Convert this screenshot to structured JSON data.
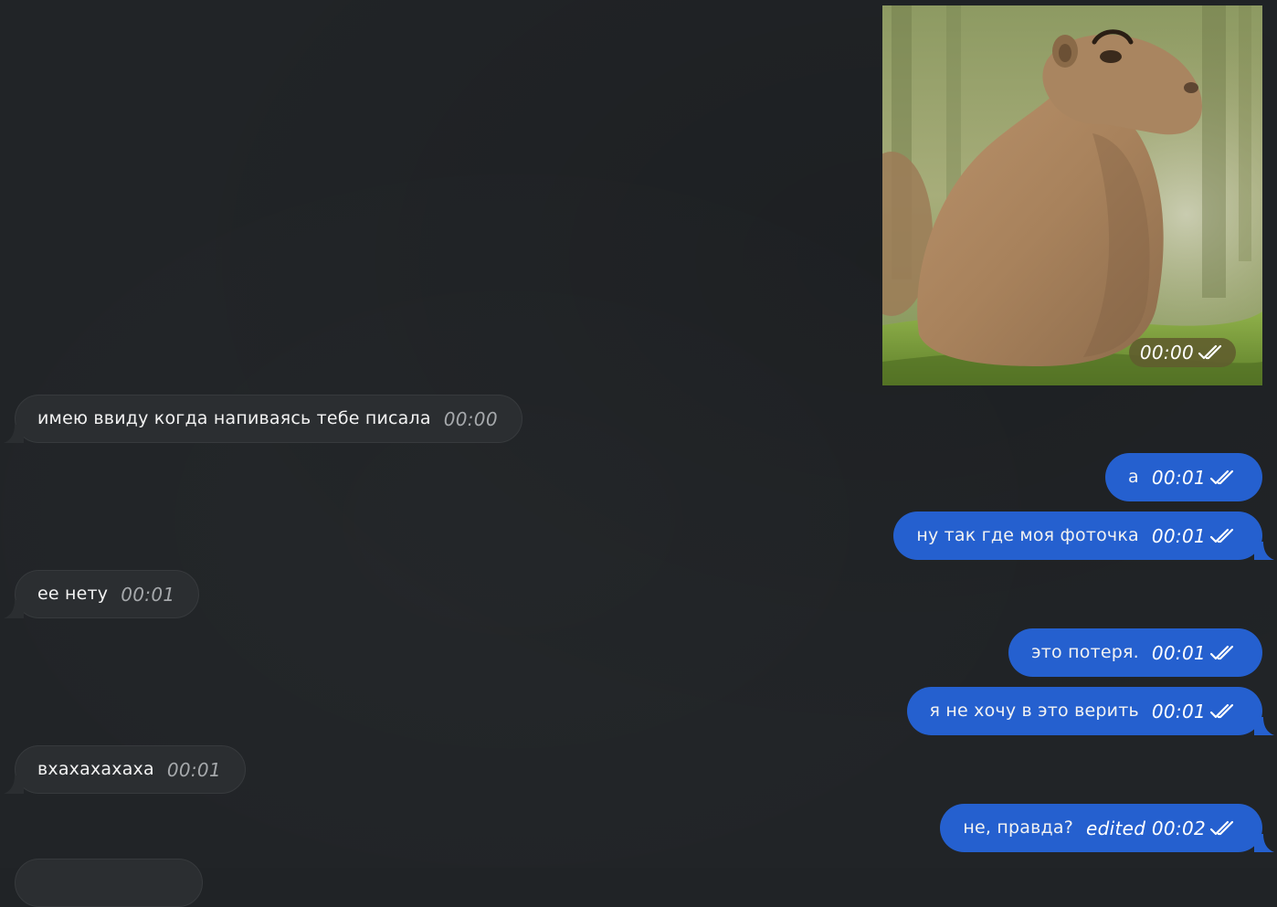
{
  "photo": {
    "time": "00:00",
    "status_icon": "double-check-icon"
  },
  "messages": [
    {
      "direction": "in",
      "text": "имею ввиду когда напиваясь тебе писала",
      "time": "00:00"
    },
    {
      "direction": "out",
      "text": "а",
      "time": "00:01",
      "status_icon": "double-check-icon"
    },
    {
      "direction": "out",
      "text": "ну так где моя фоточка",
      "time": "00:01",
      "status_icon": "double-check-icon"
    },
    {
      "direction": "in",
      "text": "ее нету",
      "time": "00:01"
    },
    {
      "direction": "out",
      "text": "это потеря.",
      "time": "00:01",
      "status_icon": "double-check-icon"
    },
    {
      "direction": "out",
      "text": "я не хочу в это верить",
      "time": "00:01",
      "status_icon": "double-check-icon"
    },
    {
      "direction": "in",
      "text": "вхахахахаха",
      "time": "00:01"
    },
    {
      "direction": "out",
      "text": "не, правда?",
      "time": "edited 00:02",
      "status_icon": "double-check-icon"
    }
  ],
  "colors": {
    "background": "#212427",
    "incoming_bubble": "#2b2e31",
    "outgoing_bubble": "#2560cf",
    "photo_time_badge": "#605c2e"
  }
}
